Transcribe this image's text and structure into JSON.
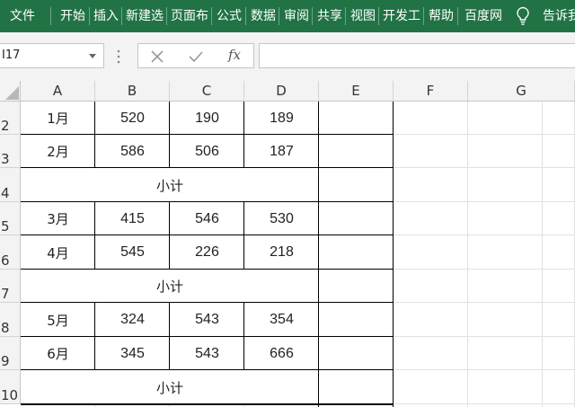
{
  "ribbon": {
    "tabs": [
      {
        "label": "文件"
      },
      {
        "label": "开始"
      },
      {
        "label": "插入"
      },
      {
        "label": "新建选"
      },
      {
        "label": "页面布"
      },
      {
        "label": "公式"
      },
      {
        "label": "数据"
      },
      {
        "label": "审阅"
      },
      {
        "label": "共享"
      },
      {
        "label": "视图"
      },
      {
        "label": "开发工"
      },
      {
        "label": "帮助"
      },
      {
        "label": "百度网"
      }
    ],
    "tell_me": "告诉我",
    "accent_color": "#217346"
  },
  "formula_bar": {
    "name_box": "I17",
    "fx_label": "fx",
    "formula": ""
  },
  "sheet": {
    "columns": [
      "A",
      "B",
      "C",
      "D",
      "E",
      "F",
      "G"
    ],
    "rows": [
      {
        "num": "2",
        "cells": [
          "1月",
          "520",
          "190",
          "189"
        ]
      },
      {
        "num": "3",
        "cells": [
          "2月",
          "586",
          "506",
          "187"
        ]
      },
      {
        "num": "4",
        "merged": "小计"
      },
      {
        "num": "5",
        "cells": [
          "3月",
          "415",
          "546",
          "530"
        ]
      },
      {
        "num": "6",
        "cells": [
          "4月",
          "545",
          "226",
          "218"
        ]
      },
      {
        "num": "7",
        "merged": "小计"
      },
      {
        "num": "8",
        "cells": [
          "5月",
          "324",
          "543",
          "354"
        ]
      },
      {
        "num": "9",
        "cells": [
          "6月",
          "345",
          "543",
          "666"
        ]
      },
      {
        "num": "10",
        "merged": "小计"
      }
    ]
  }
}
